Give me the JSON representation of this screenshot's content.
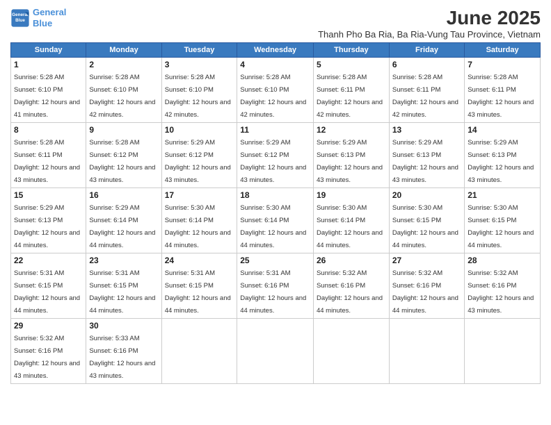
{
  "header": {
    "logo_line1": "General",
    "logo_line2": "Blue",
    "month": "June 2025",
    "location": "Thanh Pho Ba Ria, Ba Ria-Vung Tau Province, Vietnam"
  },
  "weekdays": [
    "Sunday",
    "Monday",
    "Tuesday",
    "Wednesday",
    "Thursday",
    "Friday",
    "Saturday"
  ],
  "weeks": [
    [
      {
        "day": "1",
        "sunrise": "5:28 AM",
        "sunset": "6:10 PM",
        "daylight": "12 hours and 41 minutes."
      },
      {
        "day": "2",
        "sunrise": "5:28 AM",
        "sunset": "6:10 PM",
        "daylight": "12 hours and 42 minutes."
      },
      {
        "day": "3",
        "sunrise": "5:28 AM",
        "sunset": "6:10 PM",
        "daylight": "12 hours and 42 minutes."
      },
      {
        "day": "4",
        "sunrise": "5:28 AM",
        "sunset": "6:10 PM",
        "daylight": "12 hours and 42 minutes."
      },
      {
        "day": "5",
        "sunrise": "5:28 AM",
        "sunset": "6:11 PM",
        "daylight": "12 hours and 42 minutes."
      },
      {
        "day": "6",
        "sunrise": "5:28 AM",
        "sunset": "6:11 PM",
        "daylight": "12 hours and 42 minutes."
      },
      {
        "day": "7",
        "sunrise": "5:28 AM",
        "sunset": "6:11 PM",
        "daylight": "12 hours and 43 minutes."
      }
    ],
    [
      {
        "day": "8",
        "sunrise": "5:28 AM",
        "sunset": "6:11 PM",
        "daylight": "12 hours and 43 minutes."
      },
      {
        "day": "9",
        "sunrise": "5:28 AM",
        "sunset": "6:12 PM",
        "daylight": "12 hours and 43 minutes."
      },
      {
        "day": "10",
        "sunrise": "5:29 AM",
        "sunset": "6:12 PM",
        "daylight": "12 hours and 43 minutes."
      },
      {
        "day": "11",
        "sunrise": "5:29 AM",
        "sunset": "6:12 PM",
        "daylight": "12 hours and 43 minutes."
      },
      {
        "day": "12",
        "sunrise": "5:29 AM",
        "sunset": "6:13 PM",
        "daylight": "12 hours and 43 minutes."
      },
      {
        "day": "13",
        "sunrise": "5:29 AM",
        "sunset": "6:13 PM",
        "daylight": "12 hours and 43 minutes."
      },
      {
        "day": "14",
        "sunrise": "5:29 AM",
        "sunset": "6:13 PM",
        "daylight": "12 hours and 43 minutes."
      }
    ],
    [
      {
        "day": "15",
        "sunrise": "5:29 AM",
        "sunset": "6:13 PM",
        "daylight": "12 hours and 44 minutes."
      },
      {
        "day": "16",
        "sunrise": "5:29 AM",
        "sunset": "6:14 PM",
        "daylight": "12 hours and 44 minutes."
      },
      {
        "day": "17",
        "sunrise": "5:30 AM",
        "sunset": "6:14 PM",
        "daylight": "12 hours and 44 minutes."
      },
      {
        "day": "18",
        "sunrise": "5:30 AM",
        "sunset": "6:14 PM",
        "daylight": "12 hours and 44 minutes."
      },
      {
        "day": "19",
        "sunrise": "5:30 AM",
        "sunset": "6:14 PM",
        "daylight": "12 hours and 44 minutes."
      },
      {
        "day": "20",
        "sunrise": "5:30 AM",
        "sunset": "6:15 PM",
        "daylight": "12 hours and 44 minutes."
      },
      {
        "day": "21",
        "sunrise": "5:30 AM",
        "sunset": "6:15 PM",
        "daylight": "12 hours and 44 minutes."
      }
    ],
    [
      {
        "day": "22",
        "sunrise": "5:31 AM",
        "sunset": "6:15 PM",
        "daylight": "12 hours and 44 minutes."
      },
      {
        "day": "23",
        "sunrise": "5:31 AM",
        "sunset": "6:15 PM",
        "daylight": "12 hours and 44 minutes."
      },
      {
        "day": "24",
        "sunrise": "5:31 AM",
        "sunset": "6:15 PM",
        "daylight": "12 hours and 44 minutes."
      },
      {
        "day": "25",
        "sunrise": "5:31 AM",
        "sunset": "6:16 PM",
        "daylight": "12 hours and 44 minutes."
      },
      {
        "day": "26",
        "sunrise": "5:32 AM",
        "sunset": "6:16 PM",
        "daylight": "12 hours and 44 minutes."
      },
      {
        "day": "27",
        "sunrise": "5:32 AM",
        "sunset": "6:16 PM",
        "daylight": "12 hours and 44 minutes."
      },
      {
        "day": "28",
        "sunrise": "5:32 AM",
        "sunset": "6:16 PM",
        "daylight": "12 hours and 43 minutes."
      }
    ],
    [
      {
        "day": "29",
        "sunrise": "5:32 AM",
        "sunset": "6:16 PM",
        "daylight": "12 hours and 43 minutes."
      },
      {
        "day": "30",
        "sunrise": "5:33 AM",
        "sunset": "6:16 PM",
        "daylight": "12 hours and 43 minutes."
      },
      null,
      null,
      null,
      null,
      null
    ]
  ]
}
